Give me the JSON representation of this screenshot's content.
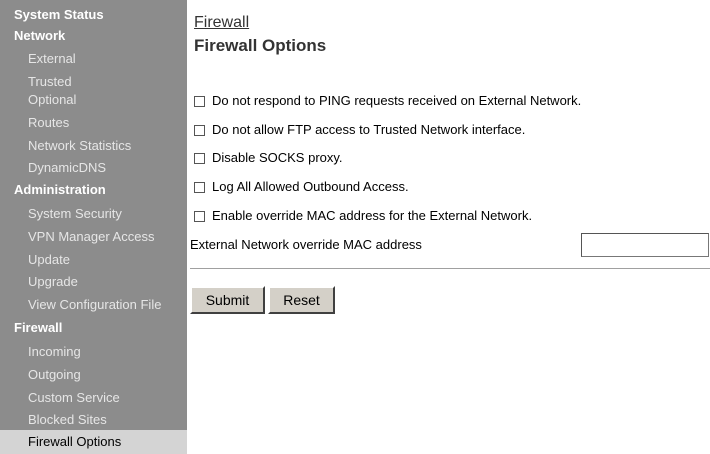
{
  "sidebar": {
    "system_status": "System Status",
    "network": {
      "heading": "Network",
      "items": [
        "External",
        "Trusted",
        "Optional",
        "Routes",
        "Network Statistics",
        "DynamicDNS"
      ]
    },
    "administration": {
      "heading": "Administration",
      "items": [
        "System Security",
        "VPN Manager Access",
        "Update",
        "Upgrade",
        "View Configuration File"
      ]
    },
    "firewall": {
      "heading": "Firewall",
      "items": [
        "Incoming",
        "Outgoing",
        "Custom Service",
        "Blocked Sites",
        "Firewall Options"
      ],
      "selected": "Firewall Options"
    }
  },
  "main": {
    "section_link": "Firewall",
    "page_title": "Firewall Options",
    "options": [
      {
        "label": "Do not respond to PING requests received on External Network.",
        "checked": false
      },
      {
        "label": "Do not allow FTP access to Trusted Network interface.",
        "checked": false
      },
      {
        "label": "Disable SOCKS proxy.",
        "checked": false
      },
      {
        "label": "Log All Allowed Outbound Access.",
        "checked": false
      },
      {
        "label": "Enable override MAC address for the External Network.",
        "checked": false
      }
    ],
    "mac_label": "External Network override MAC address",
    "mac_value": "",
    "submit_label": "Submit",
    "reset_label": "Reset"
  }
}
